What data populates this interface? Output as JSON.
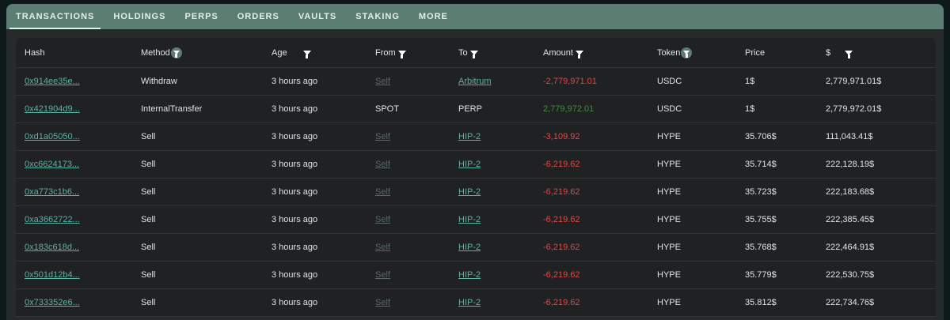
{
  "tabs": [
    "TRANSACTIONS",
    "HOLDINGS",
    "PERPS",
    "ORDERS",
    "VAULTS",
    "STAKING",
    "MORE"
  ],
  "columns": [
    "Hash",
    "Method",
    "Age",
    "From",
    "To",
    "Amount",
    "Token",
    "Price",
    "$"
  ],
  "rows": [
    {
      "hash": "0x914ee35e...",
      "method": "Withdraw",
      "age": "3 hours ago",
      "from": "Self",
      "to": "Arbitrum",
      "amount": "-2,779,971.01",
      "token": "USDC",
      "price": "1$",
      "usd": "2,779,971.01$"
    },
    {
      "hash": "0x421904d9...",
      "method": "InternalTransfer",
      "age": "3 hours ago",
      "from": "SPOT",
      "to": "PERP",
      "amount": "2,779,972.01",
      "token": "USDC",
      "price": "1$",
      "usd": "2,779,972.01$"
    },
    {
      "hash": "0xd1a05050...",
      "method": "Sell",
      "age": "3 hours ago",
      "from": "Self",
      "to": "HIP-2",
      "amount": "-3,109.92",
      "token": "HYPE",
      "price": "35.706$",
      "usd": "111,043.41$"
    },
    {
      "hash": "0xc6624173...",
      "method": "Sell",
      "age": "3 hours ago",
      "from": "Self",
      "to": "HIP-2",
      "amount": "-6,219.62",
      "token": "HYPE",
      "price": "35.714$",
      "usd": "222,128.19$"
    },
    {
      "hash": "0xa773c1b6...",
      "method": "Sell",
      "age": "3 hours ago",
      "from": "Self",
      "to": "HIP-2",
      "amount": "-6,219.62",
      "token": "HYPE",
      "price": "35.723$",
      "usd": "222,183.68$"
    },
    {
      "hash": "0xa3662722...",
      "method": "Sell",
      "age": "3 hours ago",
      "from": "Self",
      "to": "HIP-2",
      "amount": "-6,219.62",
      "token": "HYPE",
      "price": "35.755$",
      "usd": "222,385.45$"
    },
    {
      "hash": "0x183c618d...",
      "method": "Sell",
      "age": "3 hours ago",
      "from": "Self",
      "to": "HIP-2",
      "amount": "-6,219.62",
      "token": "HYPE",
      "price": "35.768$",
      "usd": "222,464.91$"
    },
    {
      "hash": "0x501d12b4...",
      "method": "Sell",
      "age": "3 hours ago",
      "from": "Self",
      "to": "HIP-2",
      "amount": "-6,219.62",
      "token": "HYPE",
      "price": "35.779$",
      "usd": "222,530.75$"
    },
    {
      "hash": "0x733352e6...",
      "method": "Sell",
      "age": "3 hours ago",
      "from": "Self",
      "to": "HIP-2",
      "amount": "-6,219.62",
      "token": "HYPE",
      "price": "35.812$",
      "usd": "222,734.76$"
    }
  ]
}
